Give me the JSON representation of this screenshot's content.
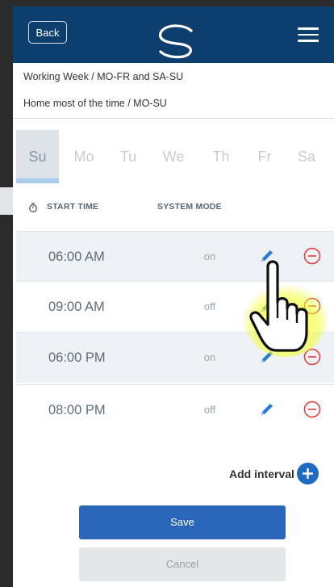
{
  "header": {
    "back_label": "Back"
  },
  "presets": [
    {
      "label": "Working Week / MO-FR and SA-SU"
    },
    {
      "label": "Home most of the time / MO-SU"
    }
  ],
  "days": [
    {
      "label": "Su",
      "active": true
    },
    {
      "label": "Mo"
    },
    {
      "label": "Tu"
    },
    {
      "label": "We"
    },
    {
      "label": "Th"
    },
    {
      "label": "Fr"
    },
    {
      "label": "Sa"
    }
  ],
  "columns": {
    "start_time": "START TIME",
    "system_mode": "SYSTEM MODE"
  },
  "intervals": [
    {
      "time": "06:00 AM",
      "mode": "on"
    },
    {
      "time": "09:00 AM",
      "mode": "off"
    },
    {
      "time": "06:00 PM",
      "mode": "on"
    },
    {
      "time": "08:00 PM",
      "mode": "off"
    }
  ],
  "add_interval_label": "Add interval",
  "save_label": "Save",
  "cancel_label": "Cancel",
  "colors": {
    "header": "#0d3f6e",
    "accent": "#2a66b9",
    "remove": "#e53935"
  },
  "icons": {
    "menu": "hamburger-icon",
    "timer": "stopwatch-icon",
    "edit": "pencil-icon",
    "remove": "minus-circle-icon",
    "add": "plus-circle-icon",
    "pointer": "pointing-hand-icon"
  }
}
